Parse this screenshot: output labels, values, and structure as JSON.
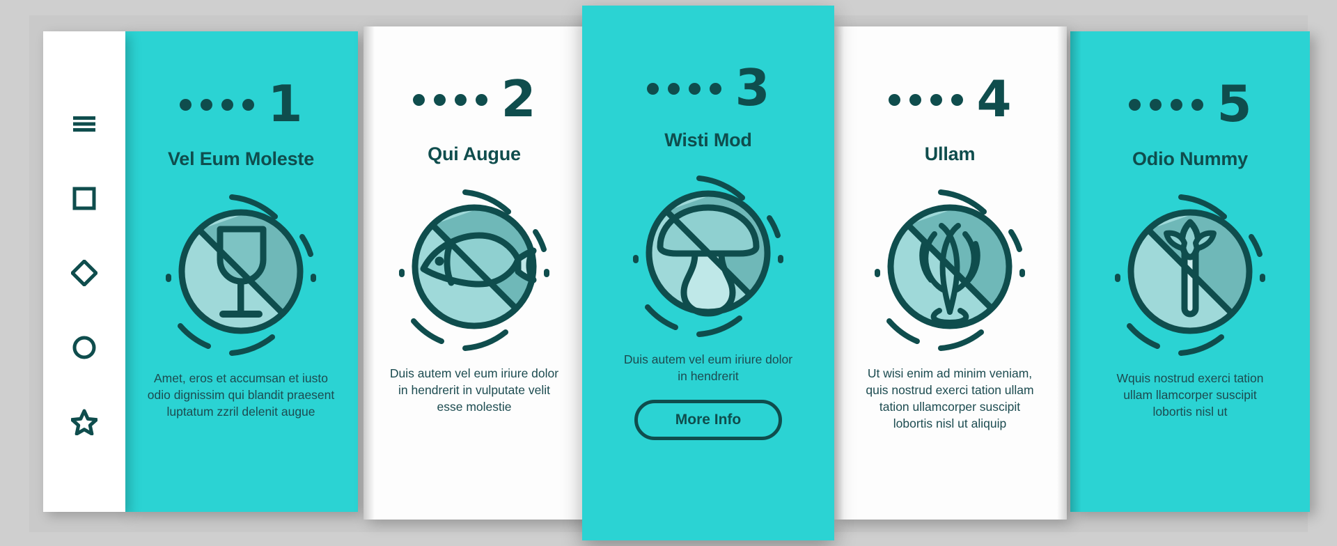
{
  "palette": {
    "teal": "#2bd3d3",
    "dark_teal": "#0f4d4d",
    "icon_light": "#9fd9d9",
    "icon_mid": "#6fb8b8",
    "icon_pale": "#bfe8e8",
    "card_white": "#fdfdfd",
    "backdrop_grey": "#cfcfcf"
  },
  "sidebar": {
    "items": [
      {
        "name": "menu-icon",
        "label": "Menu"
      },
      {
        "name": "square-icon",
        "label": "Square"
      },
      {
        "name": "diamond-icon",
        "label": "Diamond"
      },
      {
        "name": "circle-icon",
        "label": "Circle"
      },
      {
        "name": "star-icon",
        "label": "Star"
      }
    ]
  },
  "cards": [
    {
      "step": "1",
      "dots": 4,
      "title": "Vel Eum Moleste",
      "body": "Amet, eros et accumsan et iusto odio dignissim qui blandit praesent luptatum zzril delenit augue",
      "icon": "no-alcohol-icon",
      "theme": "teal",
      "button": null
    },
    {
      "step": "2",
      "dots": 4,
      "title": "Qui Augue",
      "body": "Duis autem vel eum iriure dolor in hendrerit in vulputate velit esse molestie",
      "icon": "no-fish-icon",
      "theme": "white",
      "button": null
    },
    {
      "step": "3",
      "dots": 4,
      "title": "Wisti Mod",
      "body": "Duis autem vel eum iriure dolor in hendrerit",
      "icon": "no-mushroom-icon",
      "theme": "teal",
      "button": "More Info"
    },
    {
      "step": "4",
      "dots": 4,
      "title": "Ullam",
      "body": "Ut wisi enim ad minim veniam, quis nostrud exerci tation ullam tation ullamcorper suscipit lobortis nisl ut aliquip",
      "icon": "no-seafood-icon",
      "theme": "white",
      "button": null
    },
    {
      "step": "5",
      "dots": 4,
      "title": "Odio Nummy",
      "body": "Wquis nostrud exerci tation ullam llamcorper suscipit lobortis nisl ut",
      "icon": "no-asparagus-icon",
      "theme": "teal",
      "button": null
    }
  ]
}
